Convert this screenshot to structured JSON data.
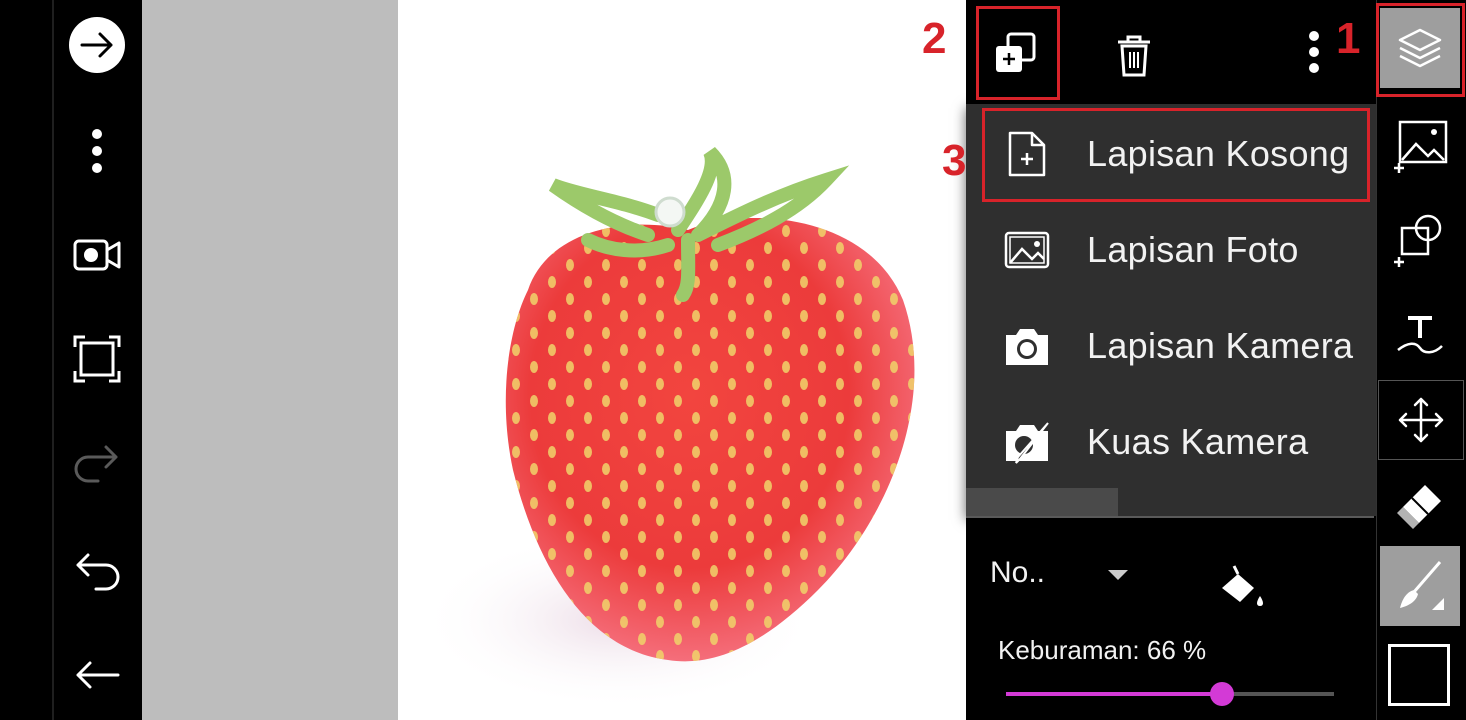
{
  "left_toolbar": {
    "items": [
      {
        "name": "forward-arrow-icon"
      },
      {
        "name": "more-vertical-icon"
      },
      {
        "name": "video-camera-icon"
      },
      {
        "name": "crop-frame-icon"
      },
      {
        "name": "redo-icon"
      },
      {
        "name": "undo-icon"
      },
      {
        "name": "back-arrow-icon"
      }
    ]
  },
  "layer_header": {
    "add_layer_icon": "add-layer-icon",
    "delete_icon": "trash-icon",
    "more_icon": "more-vertical-icon"
  },
  "add_menu": {
    "items": [
      {
        "label": "Lapisan Kosong",
        "icon": "blank-layer-icon"
      },
      {
        "label": "Lapisan Foto",
        "icon": "photo-layer-icon"
      },
      {
        "label": "Lapisan Kamera",
        "icon": "camera-layer-icon"
      },
      {
        "label": "Kuas Kamera",
        "icon": "camera-brush-icon"
      }
    ]
  },
  "layer_controls": {
    "blend_mode": "No..",
    "opacity_label": "Keburaman: 66 %",
    "opacity_value": 0.66
  },
  "annotations": {
    "step1": "1",
    "step2": "2",
    "step3": "3",
    "color": "#d8232a"
  },
  "right_tools": [
    {
      "name": "layers-icon",
      "active": true
    },
    {
      "name": "add-image-icon"
    },
    {
      "name": "add-shape-icon"
    },
    {
      "name": "text-icon"
    },
    {
      "name": "move-icon"
    },
    {
      "name": "eraser-icon"
    },
    {
      "name": "brush-icon",
      "active": true
    },
    {
      "name": "color-swatch"
    }
  ],
  "colors": {
    "accent": "#d33ad6",
    "highlight": "#d8232a",
    "menu_bg": "#2f2f2f",
    "active_tool_bg": "#9e9e9e"
  }
}
